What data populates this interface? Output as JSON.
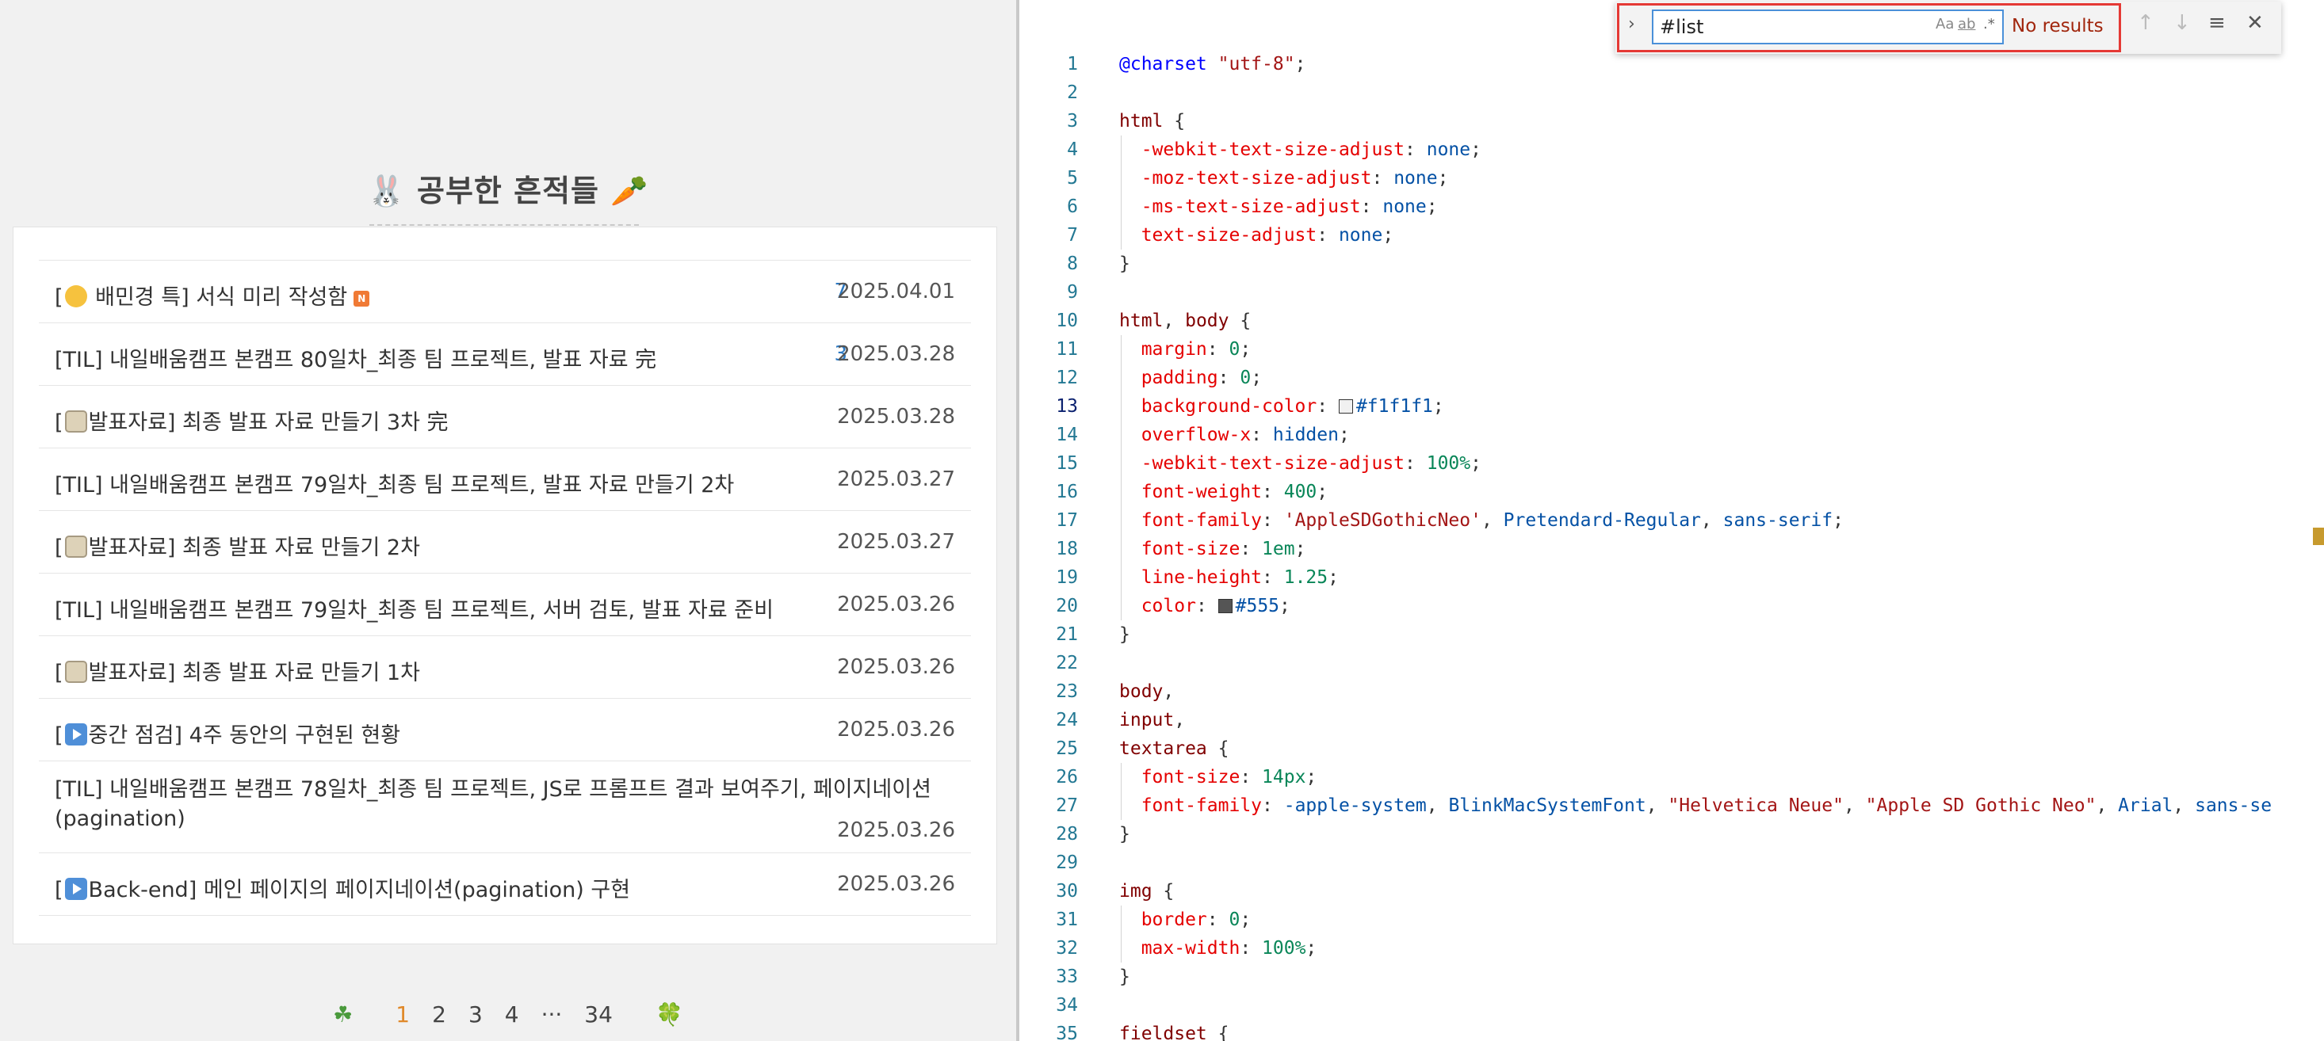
{
  "blog": {
    "section_title": "🐰 공부한 흔적들 🥕",
    "posts": [
      {
        "prefix": "[",
        "emoji": "face",
        "title": " 배민경 특] 서식 미리 작성함",
        "badge": "N",
        "count": "7",
        "date": "2025.04.01"
      },
      {
        "prefix": "",
        "emoji": "",
        "title": "[TIL] 내일배움캠프 본캠프 80일차_최종 팀 프로젝트, 발표 자료 完",
        "badge": "",
        "count": "3",
        "date": "2025.03.28"
      },
      {
        "prefix": "[",
        "emoji": "memo",
        "title": "발표자료] 최종 발표 자료 만들기 3차 完",
        "badge": "",
        "count": "",
        "date": "2025.03.28"
      },
      {
        "prefix": "",
        "emoji": "",
        "title": "[TIL] 내일배움캠프 본캠프 79일차_최종 팀 프로젝트, 발표 자료 만들기 2차",
        "badge": "",
        "count": "",
        "date": "2025.03.27"
      },
      {
        "prefix": "[",
        "emoji": "memo",
        "title": "발표자료] 최종 발표 자료 만들기 2차",
        "badge": "",
        "count": "",
        "date": "2025.03.27"
      },
      {
        "prefix": "",
        "emoji": "",
        "title": "[TIL] 내일배움캠프 본캠프 79일차_최종 팀 프로젝트, 서버 검토, 발표 자료 준비",
        "badge": "",
        "count": "",
        "date": "2025.03.26"
      },
      {
        "prefix": "[",
        "emoji": "memo",
        "title": "발표자료] 최종 발표 자료 만들기 1차",
        "badge": "",
        "count": "",
        "date": "2025.03.26"
      },
      {
        "prefix": "[",
        "emoji": "play",
        "title": "중간 점검] 4주 동안의 구현된 현황",
        "badge": "",
        "count": "",
        "date": "2025.03.26"
      },
      {
        "prefix": "",
        "emoji": "",
        "title": "[TIL] 내일배움캠프 본캠프 78일차_최종 팀 프로젝트, JS로 프롬프트 결과 보여주기, 페이지네이션(pagination)",
        "badge": "",
        "count": "",
        "date": "2025.03.26",
        "tall": true
      },
      {
        "prefix": "[",
        "emoji": "play",
        "title": "Back-end] 메인 페이지의 페이지네이션(pagination) 구현",
        "badge": "",
        "count": "",
        "date": "2025.03.26"
      }
    ],
    "pagination": {
      "prev": "☘",
      "pages": [
        "1",
        "2",
        "3",
        "4",
        "···",
        "34"
      ],
      "current": "1",
      "next": "🍀"
    }
  },
  "editor": {
    "find": {
      "query": "#list",
      "results_text": "No results",
      "opt_case": "Aa",
      "opt_word": "ab",
      "opt_regex": ".*"
    },
    "active_line": 13,
    "lines": [
      [
        [
          "k-at",
          "@charset"
        ],
        [
          "",
          " "
        ],
        [
          "k-str",
          "\"utf-8\""
        ],
        [
          "",
          ";"
        ]
      ],
      [],
      [
        [
          "k-sel",
          "html"
        ],
        [
          "",
          " {"
        ]
      ],
      [
        [
          "k-prop",
          "  -webkit-text-size-adjust"
        ],
        [
          "",
          ": "
        ],
        [
          "k-val",
          "none"
        ],
        [
          "",
          ";"
        ]
      ],
      [
        [
          "k-prop",
          "  -moz-text-size-adjust"
        ],
        [
          "",
          ": "
        ],
        [
          "k-val",
          "none"
        ],
        [
          "",
          ";"
        ]
      ],
      [
        [
          "k-prop",
          "  -ms-text-size-adjust"
        ],
        [
          "",
          ": "
        ],
        [
          "k-val",
          "none"
        ],
        [
          "",
          ";"
        ]
      ],
      [
        [
          "k-prop",
          "  text-size-adjust"
        ],
        [
          "",
          ": "
        ],
        [
          "k-val",
          "none"
        ],
        [
          "",
          ";"
        ]
      ],
      [
        [
          "",
          "}"
        ]
      ],
      [],
      [
        [
          "k-sel",
          "html"
        ],
        [
          "",
          ", "
        ],
        [
          "k-sel",
          "body"
        ],
        [
          "",
          " {"
        ]
      ],
      [
        [
          "k-prop",
          "  margin"
        ],
        [
          "",
          ": "
        ],
        [
          "k-num",
          "0"
        ],
        [
          "",
          ";"
        ]
      ],
      [
        [
          "k-prop",
          "  padding"
        ],
        [
          "",
          ": "
        ],
        [
          "k-num",
          "0"
        ],
        [
          "",
          ";"
        ]
      ],
      [
        [
          "k-prop",
          "  background-color"
        ],
        [
          "",
          ": "
        ],
        [
          "swatch",
          "#f1f1f1"
        ],
        [
          "k-val",
          "#f1f1f1"
        ],
        [
          "",
          ";"
        ]
      ],
      [
        [
          "k-prop",
          "  overflow-x"
        ],
        [
          "",
          ": "
        ],
        [
          "k-val",
          "hidden"
        ],
        [
          "",
          ";"
        ]
      ],
      [
        [
          "k-prop",
          "  -webkit-text-size-adjust"
        ],
        [
          "",
          ": "
        ],
        [
          "k-num",
          "100%"
        ],
        [
          "",
          ";"
        ]
      ],
      [
        [
          "k-prop",
          "  font-weight"
        ],
        [
          "",
          ": "
        ],
        [
          "k-num",
          "400"
        ],
        [
          "",
          ";"
        ]
      ],
      [
        [
          "k-prop",
          "  font-family"
        ],
        [
          "",
          ": "
        ],
        [
          "k-str",
          "'AppleSDGothicNeo'"
        ],
        [
          "",
          ", "
        ],
        [
          "k-val",
          "Pretendard-Regular"
        ],
        [
          "",
          ", "
        ],
        [
          "k-val",
          "sans-serif"
        ],
        [
          "",
          ";"
        ]
      ],
      [
        [
          "k-prop",
          "  font-size"
        ],
        [
          "",
          ": "
        ],
        [
          "k-num",
          "1em"
        ],
        [
          "",
          ";"
        ]
      ],
      [
        [
          "k-prop",
          "  line-height"
        ],
        [
          "",
          ": "
        ],
        [
          "k-num",
          "1.25"
        ],
        [
          "",
          ";"
        ]
      ],
      [
        [
          "k-prop",
          "  color"
        ],
        [
          "",
          ": "
        ],
        [
          "swatch",
          "#555555"
        ],
        [
          "k-val",
          "#555"
        ],
        [
          "",
          ";"
        ]
      ],
      [
        [
          "",
          "}"
        ]
      ],
      [],
      [
        [
          "k-sel",
          "body"
        ],
        [
          "",
          ","
        ]
      ],
      [
        [
          "k-sel",
          "input"
        ],
        [
          "",
          ","
        ]
      ],
      [
        [
          "k-sel",
          "textarea"
        ],
        [
          "",
          " {"
        ]
      ],
      [
        [
          "k-prop",
          "  font-size"
        ],
        [
          "",
          ": "
        ],
        [
          "k-num",
          "14px"
        ],
        [
          "",
          ";"
        ]
      ],
      [
        [
          "k-prop",
          "  font-family"
        ],
        [
          "",
          ": "
        ],
        [
          "k-val",
          "-apple-system"
        ],
        [
          "",
          ", "
        ],
        [
          "k-val",
          "BlinkMacSystemFont"
        ],
        [
          "",
          ", "
        ],
        [
          "k-str",
          "\"Helvetica Neue\""
        ],
        [
          "",
          ", "
        ],
        [
          "k-str",
          "\"Apple SD Gothic Neo\""
        ],
        [
          "",
          ", "
        ],
        [
          "k-val",
          "Arial"
        ],
        [
          "",
          ", "
        ],
        [
          "k-val",
          "sans-se"
        ]
      ],
      [
        [
          "",
          "}"
        ]
      ],
      [],
      [
        [
          "k-sel",
          "img"
        ],
        [
          "",
          " {"
        ]
      ],
      [
        [
          "k-prop",
          "  border"
        ],
        [
          "",
          ": "
        ],
        [
          "k-num",
          "0"
        ],
        [
          "",
          ";"
        ]
      ],
      [
        [
          "k-prop",
          "  max-width"
        ],
        [
          "",
          ": "
        ],
        [
          "k-num",
          "100%"
        ],
        [
          "",
          ";"
        ]
      ],
      [
        [
          "",
          "}"
        ]
      ],
      [],
      [
        [
          "k-sel",
          "fieldset"
        ],
        [
          "",
          " {"
        ]
      ]
    ]
  }
}
